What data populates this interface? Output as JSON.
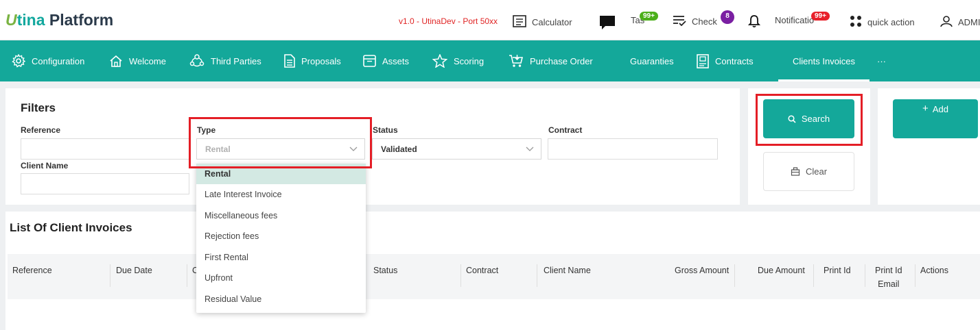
{
  "app": {
    "logo_u": "U",
    "logo_tina": "tina",
    "logo_platform": "Platform",
    "version": "v1.0 - UtinaDev - Port 50xx"
  },
  "topbar": {
    "calculator": "Calculator",
    "tasks": "Tas",
    "tasks_badge": "99+",
    "check": "Check",
    "check_badge": "8",
    "notifications": "Notificatio",
    "notifications_badge": "99+",
    "quick_action": "quick action",
    "user": "ADMI"
  },
  "nav": {
    "items": [
      {
        "label": "Configuration",
        "icon": "gear-icon"
      },
      {
        "label": "Welcome",
        "icon": "home-icon"
      },
      {
        "label": "Third Parties",
        "icon": "people-icon"
      },
      {
        "label": "Proposals",
        "icon": "document-icon"
      },
      {
        "label": "Assets",
        "icon": "box-icon"
      },
      {
        "label": "Scoring",
        "icon": "star-icon"
      },
      {
        "label": "Purchase Order",
        "icon": "cart-icon"
      },
      {
        "label": "Guaranties",
        "icon": ""
      },
      {
        "label": "Contracts",
        "icon": "contract-icon"
      },
      {
        "label": "Clients Invoices",
        "icon": ""
      },
      {
        "label": "···",
        "icon": ""
      }
    ],
    "active": "Clients Invoices"
  },
  "filters": {
    "title": "Filters",
    "reference_label": "Reference",
    "reference_value": "",
    "type_label": "Type",
    "type_value": "Rental",
    "status_label": "Status",
    "status_value": "Validated",
    "contract_label": "Contract",
    "contract_value": "",
    "client_name_label": "Client Name",
    "client_name_value": ""
  },
  "type_options": [
    "Rental",
    "Late Interest Invoice",
    "Miscellaneous fees",
    "Rejection fees",
    "First Rental",
    "Upfront",
    "Residual Value"
  ],
  "buttons": {
    "search": "Search",
    "clear": "Clear",
    "add": "Add"
  },
  "list": {
    "title": "List Of Client Invoices",
    "columns": [
      "Reference",
      "Due Date",
      "C",
      "Status",
      "Contract",
      "Client Name",
      "Gross Amount",
      "Due Amount",
      "Print Id",
      "Print Id",
      "Email",
      "Actions"
    ]
  },
  "colors": {
    "primary": "#14a89a",
    "highlight": "#e41e26",
    "version_red": "#e02424",
    "badge_green": "#4caf1a",
    "badge_purple": "#7a1fa2",
    "badge_red": "#e8202a"
  }
}
